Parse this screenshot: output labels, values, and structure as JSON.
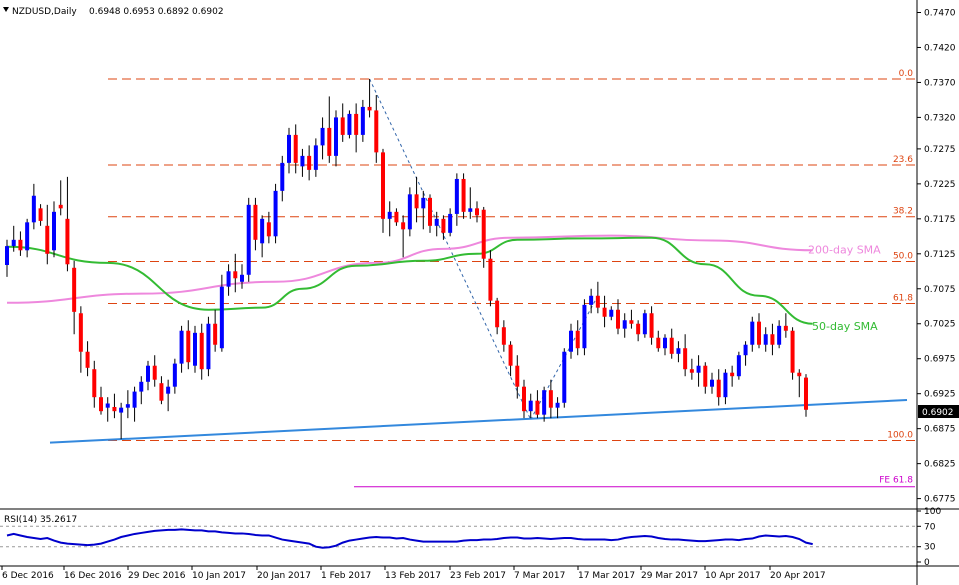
{
  "header": {
    "symbol": "NZDUSD,Daily",
    "ohlc": "0.6948 0.6953 0.6892 0.6902"
  },
  "price_badge": "0.6902",
  "colors": {
    "bull": "#0000ff",
    "bear": "#ff0000",
    "sma50": "#33bb33",
    "sma200": "#ee88dd",
    "trend": "#3388dd",
    "fib": "#dd4411",
    "fe": "#cc00cc",
    "rsi": "#0000cc"
  },
  "chart_data": {
    "type": "candlestick",
    "y_axis_ticks": [
      "0.7470",
      "0.7420",
      "0.7370",
      "0.7320",
      "0.7275",
      "0.7225",
      "0.7175",
      "0.7125",
      "0.7075",
      "0.7025",
      "0.6975",
      "0.6925",
      "0.6875",
      "0.6825",
      "0.6775"
    ],
    "x_axis_ticks": [
      "6 Dec 2016",
      "16 Dec 2016",
      "29 Dec 2016",
      "10 Jan 2017",
      "20 Jan 2017",
      "1 Feb 2017",
      "13 Feb 2017",
      "23 Feb 2017",
      "7 Mar 2017",
      "17 Mar 2017",
      "29 Mar 2017",
      "10 Apr 2017",
      "20 Apr 2017"
    ],
    "ylim": [
      0.6763,
      0.7485
    ],
    "fib_levels": [
      {
        "label": "0.0",
        "value": 0.7375
      },
      {
        "label": "23.6",
        "value": 0.7252
      },
      {
        "label": "38.2",
        "value": 0.7178
      },
      {
        "label": "50.0",
        "value": 0.7114
      },
      {
        "label": "61.8",
        "value": 0.7054
      },
      {
        "label": "100.0",
        "value": 0.6858
      }
    ],
    "fe_level": {
      "label": "FE 61.8",
      "value": 0.6792
    },
    "annotations": [
      {
        "label": "200-day SMA",
        "value": 0.713
      },
      {
        "label": "50-day SMA",
        "value": 0.7022
      }
    ],
    "candles": [
      [
        0.7109,
        0.7145,
        0.7092,
        0.7136
      ],
      [
        0.7136,
        0.7165,
        0.7128,
        0.7145
      ],
      [
        0.7145,
        0.7157,
        0.7122,
        0.713
      ],
      [
        0.713,
        0.7175,
        0.712,
        0.717
      ],
      [
        0.717,
        0.7225,
        0.716,
        0.7208
      ],
      [
        0.719,
        0.7196,
        0.7165,
        0.7172
      ],
      [
        0.7165,
        0.7195,
        0.711,
        0.7125
      ],
      [
        0.713,
        0.72,
        0.712,
        0.7185
      ],
      [
        0.7195,
        0.723,
        0.718,
        0.719
      ],
      [
        0.7175,
        0.7235,
        0.71,
        0.711
      ],
      [
        0.7105,
        0.7115,
        0.701,
        0.7042
      ],
      [
        0.704,
        0.705,
        0.6955,
        0.6985
      ],
      [
        0.6985,
        0.7,
        0.695,
        0.6962
      ],
      [
        0.696,
        0.6972,
        0.6905,
        0.692
      ],
      [
        0.692,
        0.6935,
        0.6895,
        0.69
      ],
      [
        0.6905,
        0.692,
        0.6885,
        0.6911
      ],
      [
        0.6906,
        0.6925,
        0.689,
        0.69
      ],
      [
        0.6898,
        0.6912,
        0.686,
        0.6905
      ],
      [
        0.6905,
        0.693,
        0.689,
        0.691
      ],
      [
        0.6905,
        0.6935,
        0.6885,
        0.6928
      ],
      [
        0.6928,
        0.695,
        0.691,
        0.6942
      ],
      [
        0.6942,
        0.6972,
        0.693,
        0.6965
      ],
      [
        0.6965,
        0.698,
        0.6935,
        0.6945
      ],
      [
        0.694,
        0.695,
        0.691,
        0.6915
      ],
      [
        0.6925,
        0.6945,
        0.69,
        0.6935
      ],
      [
        0.6935,
        0.6975,
        0.6925,
        0.6968
      ],
      [
        0.6968,
        0.7022,
        0.6955,
        0.7015
      ],
      [
        0.7015,
        0.703,
        0.696,
        0.697
      ],
      [
        0.6965,
        0.7022,
        0.6955,
        0.7012
      ],
      [
        0.7012,
        0.7025,
        0.6945,
        0.696
      ],
      [
        0.696,
        0.7035,
        0.695,
        0.7025
      ],
      [
        0.7025,
        0.7045,
        0.6985,
        0.6995
      ],
      [
        0.699,
        0.7095,
        0.6985,
        0.7078
      ],
      [
        0.7078,
        0.711,
        0.7065,
        0.71
      ],
      [
        0.71,
        0.7125,
        0.707,
        0.709
      ],
      [
        0.7085,
        0.711,
        0.7075,
        0.7095
      ],
      [
        0.7095,
        0.7205,
        0.7085,
        0.7195
      ],
      [
        0.7195,
        0.7205,
        0.713,
        0.7145
      ],
      [
        0.714,
        0.718,
        0.712,
        0.7175
      ],
      [
        0.717,
        0.7185,
        0.714,
        0.715
      ],
      [
        0.715,
        0.7225,
        0.714,
        0.7215
      ],
      [
        0.7215,
        0.7265,
        0.72,
        0.7255
      ],
      [
        0.7255,
        0.7305,
        0.724,
        0.7295
      ],
      [
        0.7295,
        0.731,
        0.724,
        0.7255
      ],
      [
        0.725,
        0.7275,
        0.7235,
        0.7265
      ],
      [
        0.7265,
        0.728,
        0.723,
        0.7245
      ],
      [
        0.7245,
        0.729,
        0.7235,
        0.728
      ],
      [
        0.728,
        0.732,
        0.726,
        0.7305
      ],
      [
        0.7305,
        0.735,
        0.7255,
        0.7265
      ],
      [
        0.7265,
        0.733,
        0.725,
        0.732
      ],
      [
        0.732,
        0.734,
        0.7285,
        0.7295
      ],
      [
        0.7295,
        0.733,
        0.729,
        0.7325
      ],
      [
        0.7325,
        0.734,
        0.727,
        0.7295
      ],
      [
        0.7295,
        0.7345,
        0.7285,
        0.7335
      ],
      [
        0.7335,
        0.7375,
        0.732,
        0.733
      ],
      [
        0.733,
        0.7352,
        0.7255,
        0.727
      ],
      [
        0.727,
        0.7275,
        0.7155,
        0.7175
      ],
      [
        0.7175,
        0.72,
        0.715,
        0.7185
      ],
      [
        0.7185,
        0.719,
        0.7165,
        0.717
      ],
      [
        0.717,
        0.718,
        0.712,
        0.716
      ],
      [
        0.716,
        0.722,
        0.715,
        0.721
      ],
      [
        0.721,
        0.7235,
        0.717,
        0.719
      ],
      [
        0.719,
        0.7215,
        0.716,
        0.7205
      ],
      [
        0.7205,
        0.721,
        0.7155,
        0.7165
      ],
      [
        0.7165,
        0.7185,
        0.715,
        0.7175
      ],
      [
        0.7175,
        0.718,
        0.7145,
        0.7155
      ],
      [
        0.7155,
        0.719,
        0.715,
        0.7182
      ],
      [
        0.7182,
        0.724,
        0.7165,
        0.7232
      ],
      [
        0.7232,
        0.724,
        0.7175,
        0.7185
      ],
      [
        0.7185,
        0.722,
        0.7175,
        0.719
      ],
      [
        0.719,
        0.72,
        0.717,
        0.718
      ],
      [
        0.7188,
        0.7192,
        0.7105,
        0.7118
      ],
      [
        0.7118,
        0.713,
        0.705,
        0.7058
      ],
      [
        0.7058,
        0.7062,
        0.701,
        0.702
      ],
      [
        0.702,
        0.703,
        0.6985,
        0.6995
      ],
      [
        0.6995,
        0.7,
        0.695,
        0.6965
      ],
      [
        0.6965,
        0.698,
        0.6918,
        0.6935
      ],
      [
        0.6935,
        0.6945,
        0.689,
        0.69
      ],
      [
        0.69,
        0.6925,
        0.689,
        0.6915
      ],
      [
        0.6915,
        0.693,
        0.689,
        0.6895
      ],
      [
        0.6895,
        0.6935,
        0.6885,
        0.693
      ],
      [
        0.693,
        0.6945,
        0.689,
        0.6905
      ],
      [
        0.6905,
        0.692,
        0.689,
        0.6912
      ],
      [
        0.6912,
        0.699,
        0.6905,
        0.6985
      ],
      [
        0.6985,
        0.7025,
        0.6975,
        0.7015
      ],
      [
        0.7015,
        0.703,
        0.698,
        0.699
      ],
      [
        0.699,
        0.706,
        0.698,
        0.7052
      ],
      [
        0.7052,
        0.7075,
        0.704,
        0.7065
      ],
      [
        0.7065,
        0.7085,
        0.704,
        0.7048
      ],
      [
        0.7048,
        0.7065,
        0.702,
        0.7035
      ],
      [
        0.7035,
        0.705,
        0.703,
        0.7045
      ],
      [
        0.7045,
        0.706,
        0.701,
        0.7018
      ],
      [
        0.7018,
        0.704,
        0.7005,
        0.703
      ],
      [
        0.703,
        0.7045,
        0.7018,
        0.7025
      ],
      [
        0.7025,
        0.703,
        0.7,
        0.701
      ],
      [
        0.701,
        0.7045,
        0.7005,
        0.704
      ],
      [
        0.704,
        0.705,
        0.6995,
        0.7005
      ],
      [
        0.7005,
        0.7015,
        0.6985,
        0.699
      ],
      [
        0.699,
        0.701,
        0.698,
        0.7005
      ],
      [
        0.7005,
        0.7018,
        0.6975,
        0.6982
      ],
      [
        0.6982,
        0.7,
        0.697,
        0.699
      ],
      [
        0.699,
        0.701,
        0.695,
        0.696
      ],
      [
        0.696,
        0.6975,
        0.6945,
        0.6955
      ],
      [
        0.6955,
        0.698,
        0.6935,
        0.6965
      ],
      [
        0.6965,
        0.697,
        0.6925,
        0.6935
      ],
      [
        0.6935,
        0.6955,
        0.6925,
        0.6945
      ],
      [
        0.6945,
        0.696,
        0.6908,
        0.692
      ],
      [
        0.692,
        0.696,
        0.691,
        0.6955
      ],
      [
        0.6955,
        0.6965,
        0.6935,
        0.695
      ],
      [
        0.695,
        0.6985,
        0.6945,
        0.698
      ],
      [
        0.698,
        0.7,
        0.6965,
        0.6995
      ],
      [
        0.6995,
        0.7035,
        0.6985,
        0.7028
      ],
      [
        0.7028,
        0.704,
        0.699,
        0.6995
      ],
      [
        0.6995,
        0.702,
        0.6985,
        0.701
      ],
      [
        0.701,
        0.7025,
        0.698,
        0.6995
      ],
      [
        0.6995,
        0.703,
        0.699,
        0.7022
      ],
      [
        0.7022,
        0.704,
        0.7005,
        0.7015
      ],
      [
        0.7015,
        0.702,
        0.6945,
        0.6955
      ],
      [
        0.6955,
        0.696,
        0.692,
        0.695
      ],
      [
        0.6948,
        0.6953,
        0.6892,
        0.6902
      ]
    ],
    "sma50": [
      [
        0,
        0.7135
      ],
      [
        15,
        0.7112
      ],
      [
        30,
        0.7045
      ],
      [
        38,
        0.7048
      ],
      [
        44,
        0.7075
      ],
      [
        52,
        0.7108
      ],
      [
        62,
        0.7115
      ],
      [
        70,
        0.7125
      ],
      [
        76,
        0.7145
      ],
      [
        86,
        0.7147
      ],
      [
        96,
        0.7148
      ],
      [
        104,
        0.711
      ],
      [
        112,
        0.7065
      ],
      [
        120,
        0.7025
      ]
    ],
    "sma200": [
      [
        0,
        0.7055
      ],
      [
        20,
        0.7068
      ],
      [
        40,
        0.7085
      ],
      [
        55,
        0.7112
      ],
      [
        65,
        0.7132
      ],
      [
        75,
        0.7148
      ],
      [
        90,
        0.7151
      ],
      [
        105,
        0.7144
      ],
      [
        120,
        0.713
      ]
    ],
    "trendline": [
      [
        0,
        0.6855
      ],
      [
        121,
        0.6916
      ]
    ],
    "fib_swing": [
      [
        54,
        0.7375
      ],
      [
        78,
        0.6888
      ]
    ],
    "fib_swing_2": [
      [
        78,
        0.6888
      ],
      [
        88,
        0.7065
      ]
    ]
  },
  "rsi": {
    "label": "RSI(14) 35.2617",
    "ticks": [
      "100",
      "70",
      "30",
      "0"
    ],
    "values": [
      52,
      55,
      52,
      49,
      47,
      45,
      47,
      42,
      38,
      36,
      35,
      34,
      33,
      34,
      36,
      40,
      44,
      49,
      52,
      55,
      57,
      59,
      61,
      62,
      63,
      63,
      64,
      63,
      62,
      62,
      60,
      60,
      58,
      57,
      56,
      56,
      55,
      53,
      52,
      52,
      48,
      44,
      42,
      40,
      38,
      36,
      30,
      28,
      29,
      32,
      38,
      42,
      44,
      46,
      48,
      49,
      48,
      48,
      46,
      47,
      44,
      42,
      40,
      40,
      40,
      40,
      40,
      40,
      42,
      43,
      43,
      44,
      44,
      45,
      47,
      48,
      48,
      46,
      46,
      47,
      46,
      45,
      46,
      47,
      47,
      45,
      44,
      44,
      44,
      44,
      43,
      44,
      47,
      49,
      50,
      51,
      50,
      47,
      45,
      44,
      44,
      43,
      42,
      41,
      41,
      42,
      43,
      44,
      44,
      43,
      45,
      46,
      50,
      52,
      51,
      50,
      51,
      49,
      45,
      38,
      35
    ]
  }
}
